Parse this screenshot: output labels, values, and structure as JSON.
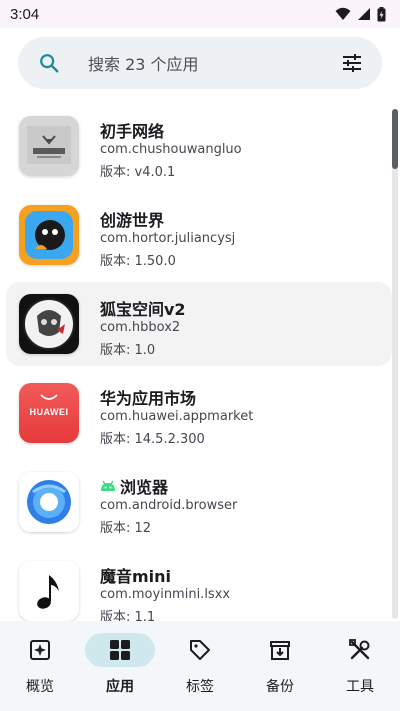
{
  "status": {
    "time": "3:04"
  },
  "search": {
    "placeholder": "搜索 23 个应用"
  },
  "apps": [
    {
      "name": "初手网络",
      "package": "com.chushouwangluo",
      "version": "版本: v4.0.1"
    },
    {
      "name": "创游世界",
      "package": "com.hortor.juliancysj",
      "version": "版本: 1.50.0"
    },
    {
      "name": "狐宝空间v2",
      "package": "com.hbbox2",
      "version": "版本: 1.0"
    },
    {
      "name": "华为应用市场",
      "package": "com.huawei.appmarket",
      "version": "版本: 14.5.2.300",
      "icon_text": "HUAWEI"
    },
    {
      "name": "浏览器",
      "package": "com.android.browser",
      "version": "版本: 12"
    },
    {
      "name": "魔音mini",
      "package": "com.moyinmini.lsxx",
      "version": "版本: 1.1"
    }
  ],
  "nav": [
    {
      "label": "概览",
      "icon": "overview-icon"
    },
    {
      "label": "应用",
      "icon": "apps-grid-icon"
    },
    {
      "label": "标签",
      "icon": "tag-icon"
    },
    {
      "label": "备份",
      "icon": "archive-icon"
    },
    {
      "label": "工具",
      "icon": "tools-icon"
    }
  ],
  "colors": {
    "accent": "#1a8a9a",
    "nav_active": "#cfe8ee",
    "search_bg": "#eef1f4"
  }
}
